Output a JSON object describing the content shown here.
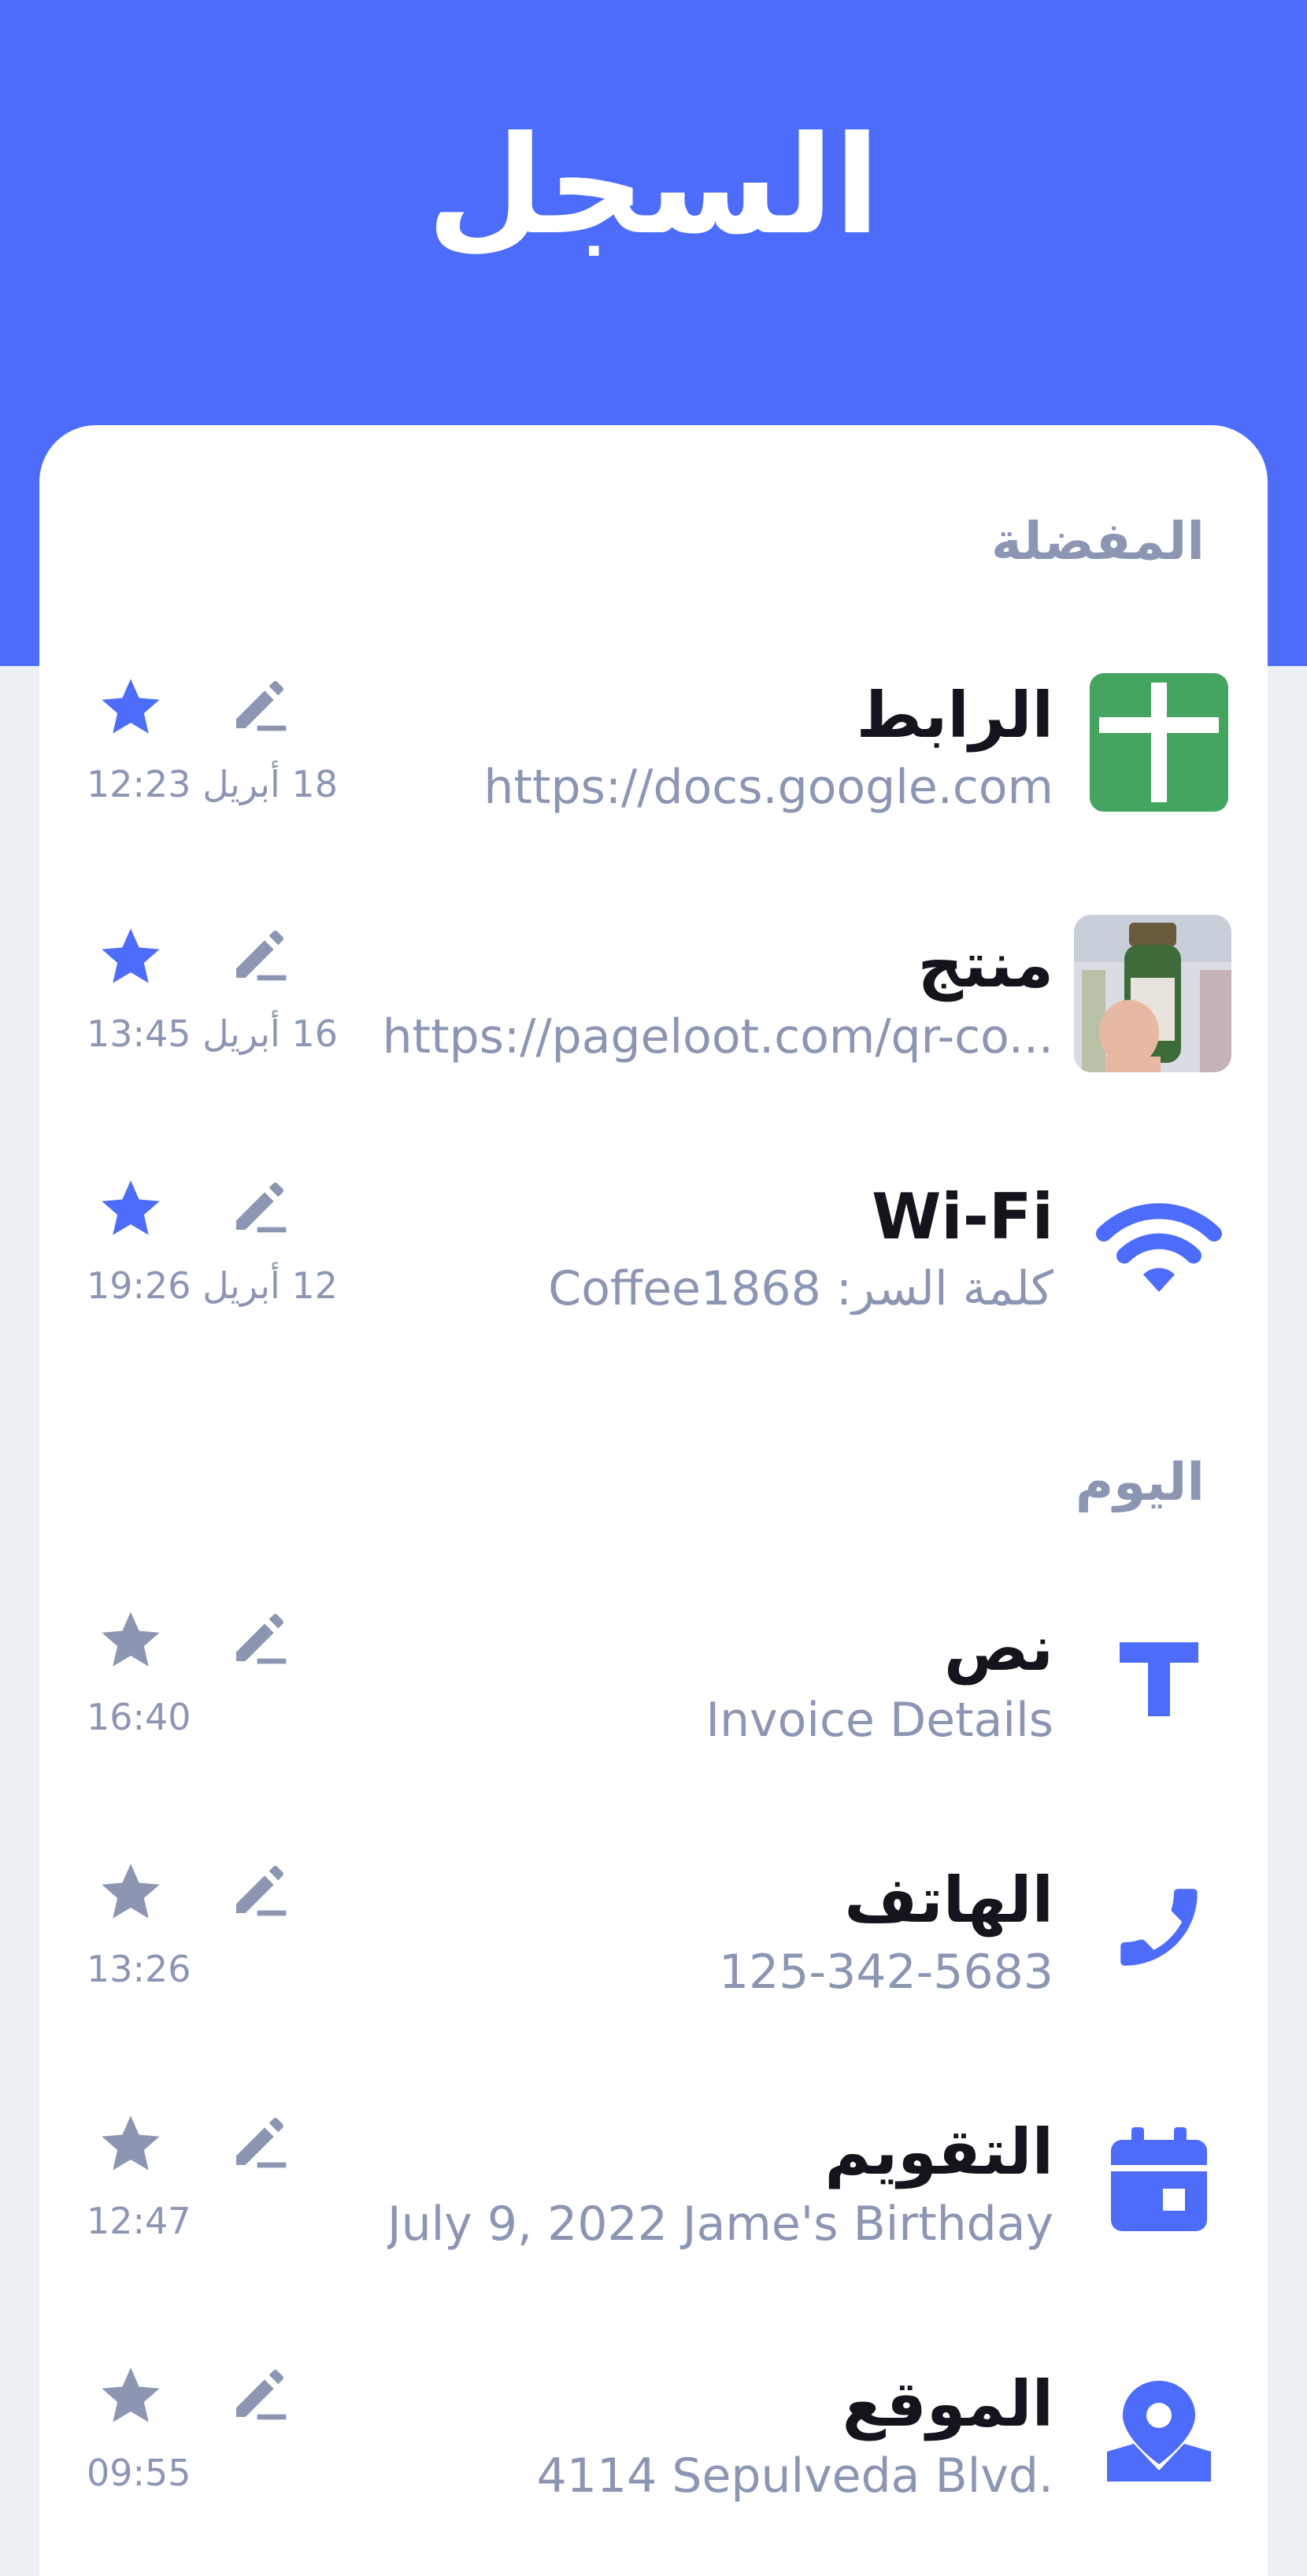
{
  "header": {
    "title": "السجل"
  },
  "sections": {
    "favorites": "المفضلة",
    "today": "اليوم"
  },
  "favorites": [
    {
      "title": "الرابط",
      "subtitle": "https://docs.google.com",
      "time": "18 أبريل 12:23",
      "starred": true,
      "icon": "google-docs-icon"
    },
    {
      "title": "منتج",
      "subtitle": "https://pageloot.com/qr-co...",
      "time": "16 أبريل 13:45",
      "starred": true,
      "icon": "product-photo"
    },
    {
      "title": "Wi-Fi",
      "subtitle": "كلمة السر: Coffee1868",
      "time": "12 أبريل 19:26",
      "starred": true,
      "icon": "wifi-icon"
    }
  ],
  "today": [
    {
      "title": "نص",
      "subtitle": "Invoice Details",
      "time": "16:40",
      "starred": false,
      "icon": "text-icon"
    },
    {
      "title": "الهاتف",
      "subtitle": "125-342-5683",
      "time": "13:26",
      "starred": false,
      "icon": "phone-icon"
    },
    {
      "title": "التقويم",
      "subtitle": "July 9, 2022 Jame's Birthday",
      "time": "12:47",
      "starred": false,
      "icon": "calendar-icon"
    },
    {
      "title": "الموقع",
      "subtitle": "4114 Sepulveda Blvd.",
      "time": "09:55",
      "starred": false,
      "icon": "location-icon"
    }
  ],
  "colors": {
    "accent": "#4d6cfa",
    "muted": "#8c96b3",
    "text": "#14151c",
    "google_green": "#45a560",
    "background": "#eceff3"
  }
}
